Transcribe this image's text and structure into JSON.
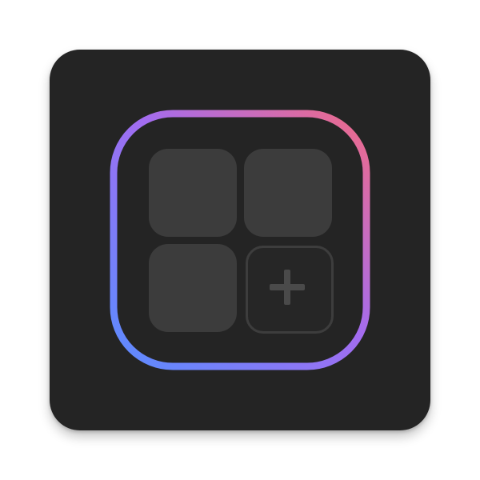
{
  "icon": {
    "name": "widget-grid-app-icon",
    "background_color": "#242424",
    "tile_color": "#3c3c3c",
    "add_tile_border_color": "#3d3d3d",
    "plus_color": "#4a4a4a",
    "gradient_colors": [
      "#f06b87",
      "#a36cf0",
      "#5a8cff"
    ],
    "tiles": [
      "tile",
      "tile",
      "tile",
      "add-tile"
    ],
    "add_symbol": "plus-icon"
  }
}
